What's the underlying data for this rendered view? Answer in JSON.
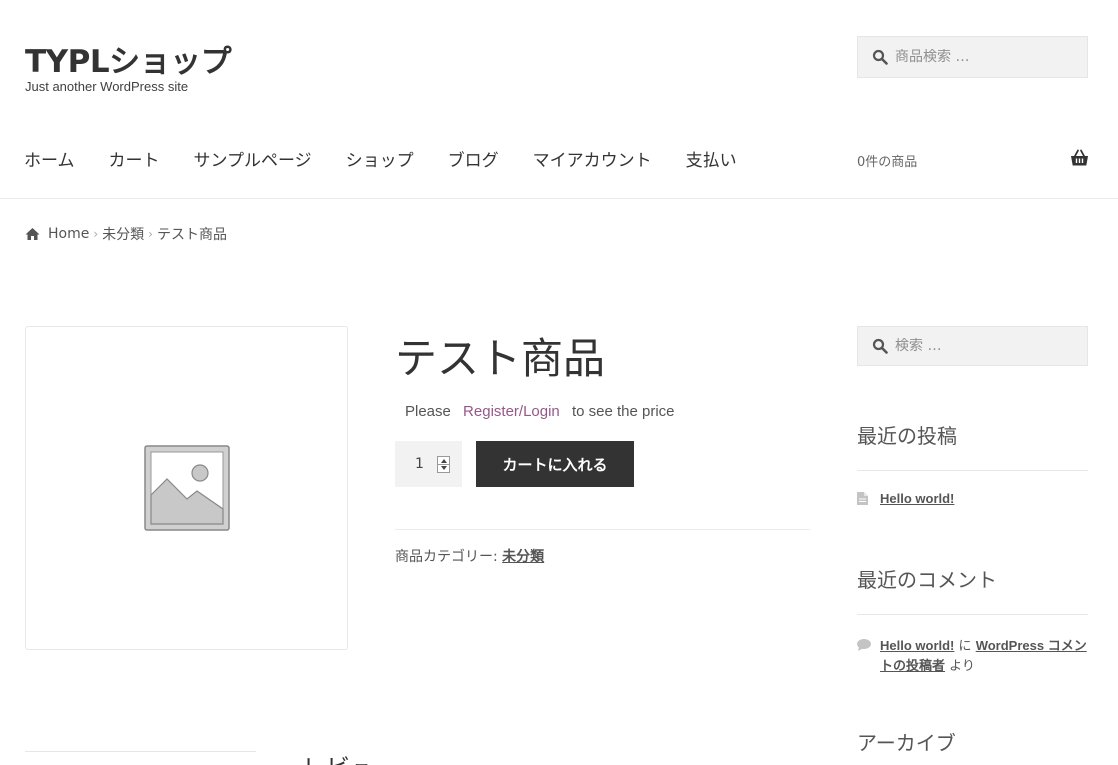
{
  "header": {
    "site_title": "TYPLショップ",
    "site_description": "Just another WordPress site",
    "search_placeholder": "商品検索 …",
    "cart_count": "0件の商品"
  },
  "nav": {
    "items": [
      "ホーム",
      "カート",
      "サンプルページ",
      "ショップ",
      "ブログ",
      "マイアカウント",
      "支払い"
    ]
  },
  "breadcrumb": {
    "home": "Home",
    "category": "未分類",
    "current": "テスト商品"
  },
  "product": {
    "title": "テスト商品",
    "price_prefix": "Please",
    "price_link": "Register/Login",
    "price_suffix": "to see the price",
    "quantity": "1",
    "add_to_cart_label": "カートに入れる",
    "category_label": "商品カテゴリー:",
    "category_value": "未分類"
  },
  "sidebar": {
    "search_placeholder": "検索 …",
    "recent_posts_title": "最近の投稿",
    "recent_post": "Hello world!",
    "recent_comments_title": "最近のコメント",
    "comment_post": "Hello world!",
    "comment_joiner": "に",
    "comment_author": "WordPress コメントの投稿者",
    "comment_suffix": "より",
    "archive_title": "アーカイブ"
  },
  "reviews": {
    "title_partial": "レビュー"
  },
  "colors": {
    "text": "#333333",
    "link_accent": "#96588a",
    "button_bg": "#333333",
    "field_bg": "#f2f2f2"
  }
}
